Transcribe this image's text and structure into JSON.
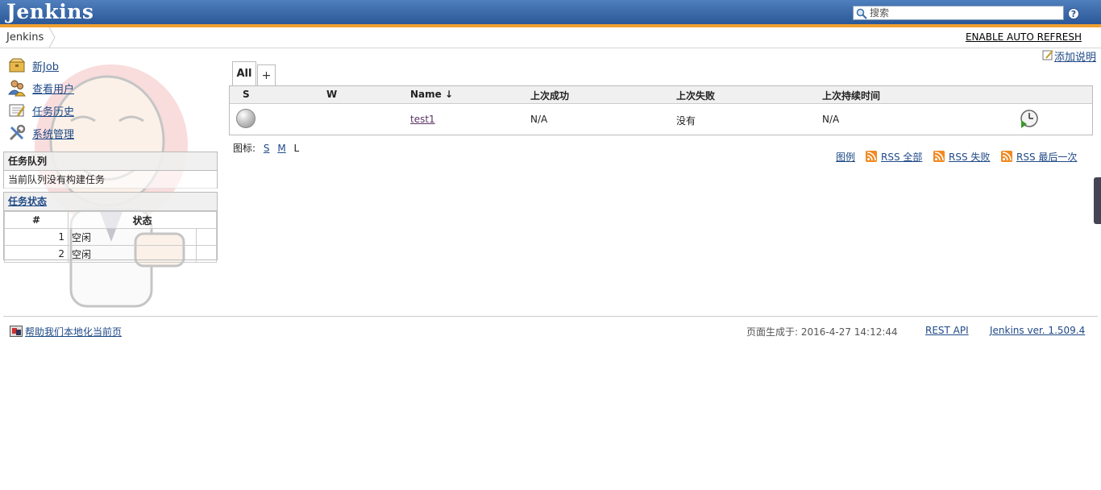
{
  "header": {
    "logo_text": "Jenkins",
    "search_placeholder": "搜索",
    "help_label": "?"
  },
  "breadcrumb": {
    "items": [
      "Jenkins"
    ],
    "auto_refresh": "ENABLE AUTO REFRESH"
  },
  "sidebar": {
    "tasks": [
      {
        "label": "新Job",
        "icon": "new-job-icon"
      },
      {
        "label": "查看用户",
        "icon": "people-icon"
      },
      {
        "label": "任务历史",
        "icon": "build-history-icon"
      },
      {
        "label": "系统管理",
        "icon": "manage-jenkins-icon"
      }
    ],
    "build_queue": {
      "title": "任务队列",
      "empty_text": "当前队列没有构建任务"
    },
    "executors": {
      "title": "任务状态",
      "columns": [
        "#",
        "状态"
      ],
      "rows": [
        {
          "number": "1",
          "status": "空闲"
        },
        {
          "number": "2",
          "status": "空闲"
        }
      ]
    }
  },
  "main": {
    "add_description": "添加说明",
    "tabs": [
      {
        "label": "All",
        "active": true
      },
      {
        "label": "+"
      }
    ],
    "job_table": {
      "columns": {
        "s": "S",
        "w": "W",
        "name": "Name ↓",
        "last_success": "上次成功",
        "last_failure": "上次失败",
        "last_duration": "上次持续时间"
      },
      "rows": [
        {
          "name": "test1",
          "last_success": "N/A",
          "last_failure": "没有",
          "last_duration": "N/A",
          "status_color": "#aaaaaa"
        }
      ]
    },
    "icon_sizes": {
      "label": "图标:",
      "sizes": [
        "S",
        "M",
        "L"
      ]
    },
    "rss": {
      "legend": "图例",
      "all": "RSS 全部",
      "failures": "RSS 失败",
      "latest": "RSS 最后一次"
    }
  },
  "footer": {
    "localize": "帮助我们本地化当前页",
    "page_generated": "页面生成于: 2016-4-27 14:12:44",
    "rest_api": "REST API",
    "version": "Jenkins ver. 1.509.4"
  },
  "colors": {
    "header_blue": "#2b5797",
    "stripe_orange": "#f0a030",
    "link_blue": "#204a87"
  }
}
